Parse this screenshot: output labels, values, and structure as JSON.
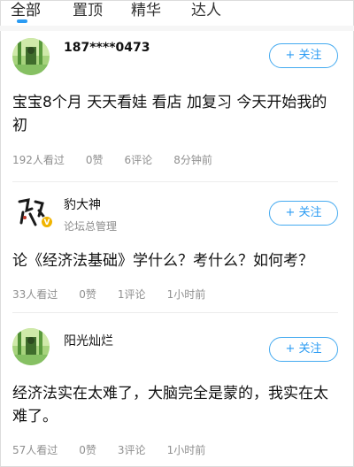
{
  "tabs": [
    {
      "label": "全部",
      "active": true
    },
    {
      "label": "置顶",
      "active": false
    },
    {
      "label": "精华",
      "active": false
    },
    {
      "label": "达人",
      "active": false
    }
  ],
  "accent_color": "#2a9bf3",
  "posts": [
    {
      "username": "187****0473",
      "user_tag": "",
      "avatar_icon": "bamboo-avatar-icon",
      "follow_label": "关注",
      "content": "宝宝8个月 天天看娃 看店 加复习 今天开始我的初",
      "views": "192人看过",
      "likes": "0赞",
      "comments": "6评论",
      "time": "8分钟前"
    },
    {
      "username": "豹大神",
      "user_tag": "论坛总管理",
      "avatar_icon": "calligraphy-avatar-icon",
      "badge": "V",
      "follow_label": "关注",
      "content": "论《经济法基础》学什么？考什么？如何考？",
      "views": "33人看过",
      "likes": "0赞",
      "comments": "1评论",
      "time": "1小时前"
    },
    {
      "username": "阳光灿烂",
      "user_tag": "",
      "avatar_icon": "bamboo-avatar-icon",
      "follow_label": "关注",
      "content": "经济法实在太难了，大脑完全是蒙的，我实在太难了。",
      "views": "57人看过",
      "likes": "0赞",
      "comments": "3评论",
      "time": "1小时前"
    }
  ]
}
